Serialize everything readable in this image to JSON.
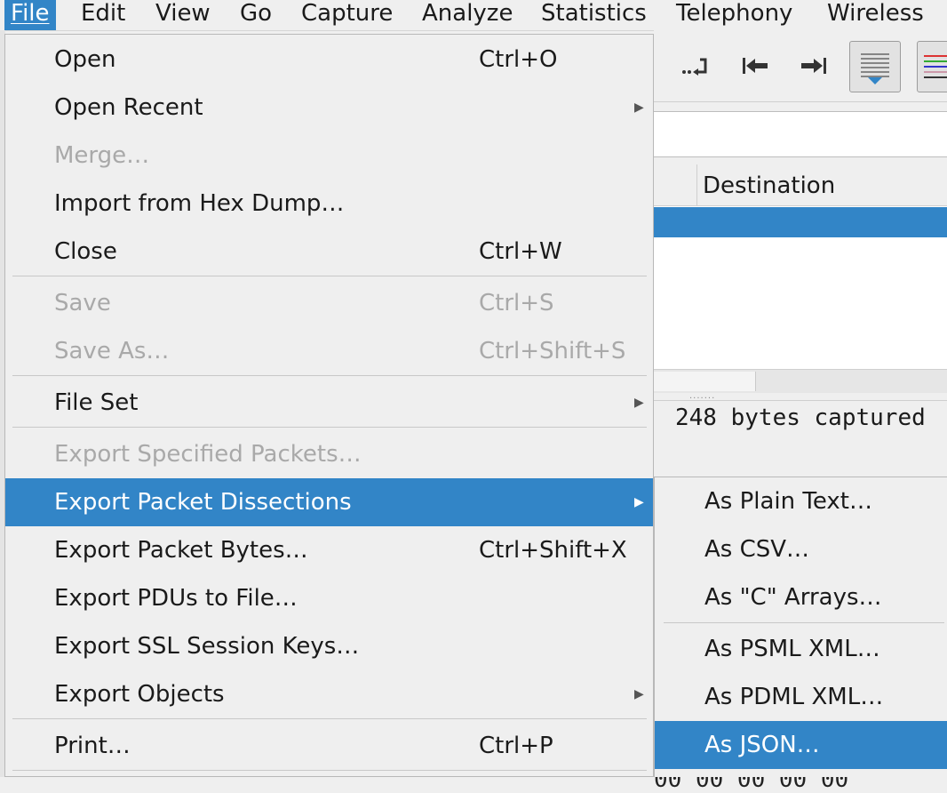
{
  "menubar": {
    "file": "File",
    "edit": "Edit",
    "view": "View",
    "go": "Go",
    "capture": "Capture",
    "analyze": "Analyze",
    "statistics": "Statistics",
    "telephony": "Telephony",
    "wireless": "Wireless"
  },
  "toolbar": {
    "icons": [
      "go-to-packet-icon",
      "first-packet-icon",
      "last-packet-icon",
      "autoscroll-icon",
      "colorize-icon"
    ]
  },
  "packet_list": {
    "column_destination": "Destination"
  },
  "details": {
    "summary": "248 bytes captured"
  },
  "bytes_pane": {
    "partial_row": "00 00 00 00 00"
  },
  "file_menu": {
    "open": {
      "label": "Open",
      "shortcut": "Ctrl+O"
    },
    "open_recent": {
      "label": "Open Recent"
    },
    "merge": {
      "label": "Merge…"
    },
    "import_hex": {
      "label": "Import from Hex Dump…"
    },
    "close": {
      "label": "Close",
      "shortcut": "Ctrl+W"
    },
    "save": {
      "label": "Save",
      "shortcut": "Ctrl+S"
    },
    "save_as": {
      "label": "Save As…",
      "shortcut": "Ctrl+Shift+S"
    },
    "file_set": {
      "label": "File Set"
    },
    "export_specified": {
      "label": "Export Specified Packets…"
    },
    "export_dissections": {
      "label": "Export Packet Dissections"
    },
    "export_bytes": {
      "label": "Export Packet Bytes…",
      "shortcut": "Ctrl+Shift+X"
    },
    "export_pdus": {
      "label": "Export PDUs to File…"
    },
    "export_ssl": {
      "label": "Export SSL Session Keys…"
    },
    "export_objects": {
      "label": "Export Objects"
    },
    "print": {
      "label": "Print…",
      "shortcut": "Ctrl+P"
    }
  },
  "submenu": {
    "plain_text": "As Plain Text…",
    "csv": "As CSV…",
    "c_arrays": "As \"C\" Arrays…",
    "psml": "As PSML XML…",
    "pdml": "As PDML XML…",
    "json": "As JSON…"
  },
  "colors": {
    "highlight": "#3285c7",
    "menu_bg": "#efefef",
    "disabled_text": "#a9a9a9"
  }
}
